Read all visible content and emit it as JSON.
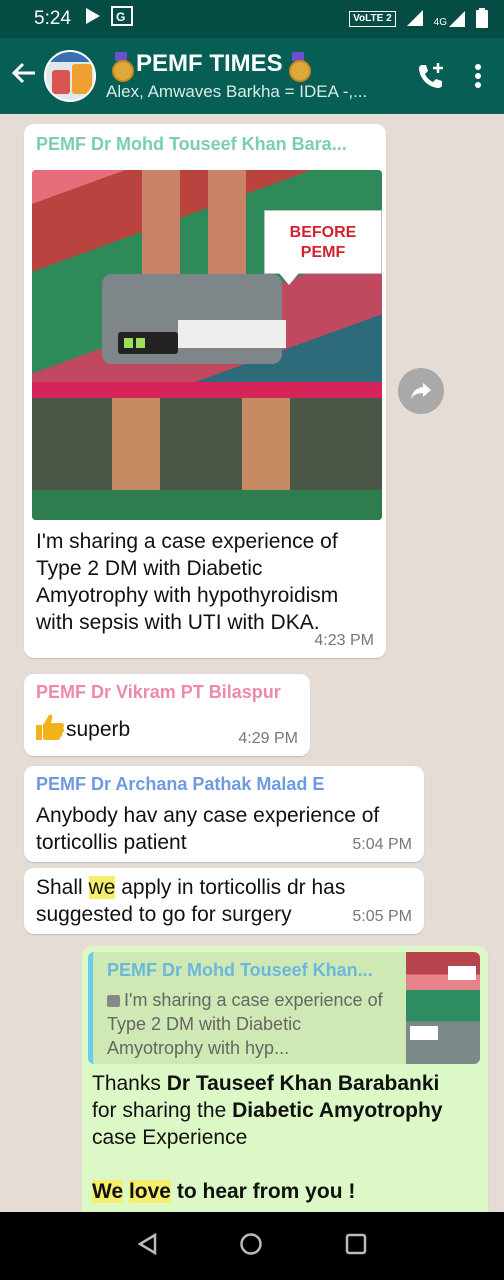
{
  "status_bar": {
    "time": "5:24",
    "volte_label": "VoLTE 2",
    "network_label": "4G"
  },
  "header": {
    "title": "PEMF TIMES",
    "subtitle": "Alex, Amwaves Barkha = IDEA -,..."
  },
  "messages": [
    {
      "sender": "PEMF Dr Mohd Touseef Khan Bara...",
      "sender_color": "#7bcdb3",
      "image_overlay_lines": [
        "BEFORE",
        "PEMF"
      ],
      "text": "I'm sharing a case experience of Type 2 DM with Diabetic Amyotrophy with hypothyroidism with sepsis with UTI with DKA.",
      "time": "4:23 PM"
    },
    {
      "sender": "PEMF Dr Vikram PT Bilaspur",
      "sender_color": "#ee8aa8",
      "text": "superb",
      "time": "4:29 PM"
    },
    {
      "sender": "PEMF Dr Archana Pathak Malad E",
      "sender_color": "#6f9ae0",
      "text": "Anybody hav any case experience  of torticollis patient",
      "time": "5:04 PM"
    },
    {
      "text_before": "Shall ",
      "text_highlight": "we",
      "text_after": " apply in torticollis dr has suggested to go for surgery",
      "time": "5:05 PM"
    }
  ],
  "reply": {
    "quote_sender": "PEMF Dr Mohd Touseef Khan...",
    "quote_text": "I'm sharing a case experience of Type 2 DM with Diabetic Amyotrophy with hyp...",
    "line1_plain": "Thanks ",
    "line1_bold": "Dr Tauseef Khan Barabanki",
    "line2_plain": "for sharing the ",
    "line2_bold": "Diabetic Amyotrophy",
    "line3": "case Experience",
    "line4_we": "We",
    "line4_love": "love",
    "line4_rest": " to hear from you !"
  },
  "colors": {
    "header_bg": "#075e54",
    "chat_bg": "#e5ddd5",
    "outgoing_bubble": "#dcf8c6"
  }
}
